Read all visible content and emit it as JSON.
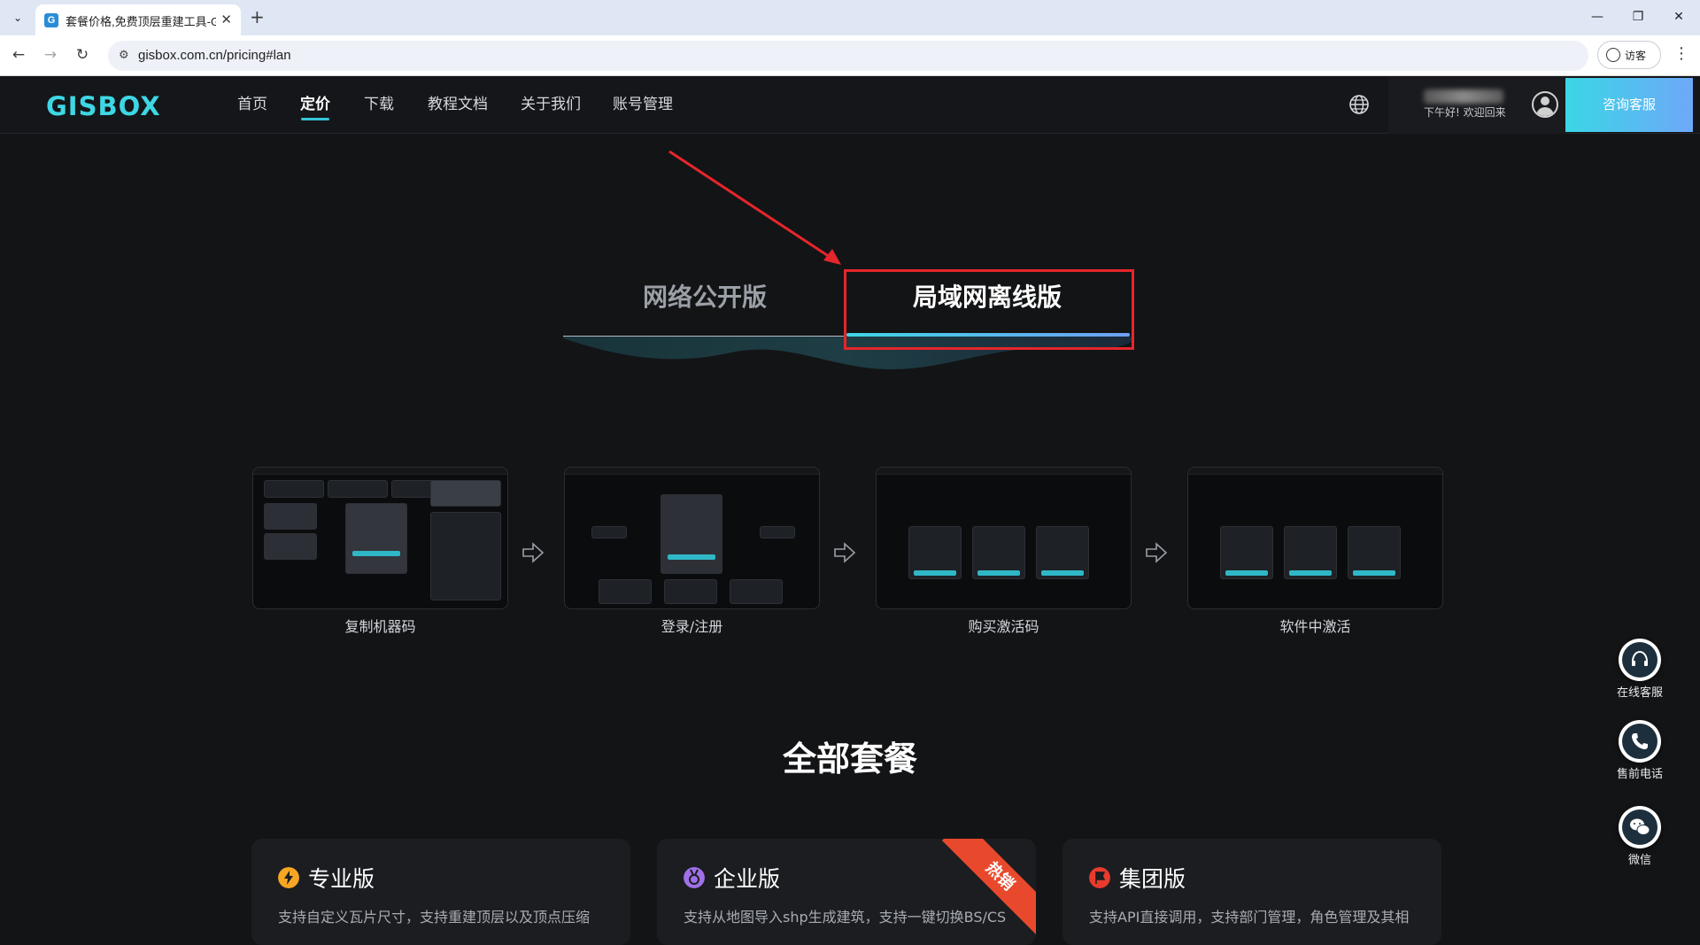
{
  "browser": {
    "tab_title": "套餐价格,免费顶层重建工具-GI",
    "tab_favicon": "G",
    "tab_close": "✕",
    "new_tab": "+",
    "url": "gisbox.com.cn/pricing#lan",
    "guest_label": "访客",
    "window_controls": {
      "minimize": "—",
      "restore": "❐",
      "close": "✕"
    }
  },
  "site": {
    "logo": "GISBOX",
    "nav": [
      "首页",
      "定价",
      "下载",
      "教程文档",
      "关于我们",
      "账号管理"
    ],
    "active_nav": "定价",
    "greeting": "下午好! 欢迎回来",
    "consult_button": "咨询客服"
  },
  "switcher": {
    "tabs": [
      "网络公开版",
      "局域网离线版"
    ],
    "active": "局域网离线版"
  },
  "steps": [
    "复制机器码",
    "登录/注册",
    "购买激活码",
    "软件中激活"
  ],
  "plans": {
    "title": "全部套餐",
    "items": [
      {
        "name": "专业版",
        "icon": "lightning-icon",
        "icon_color": "#f5a623",
        "desc": "支持自定义瓦片尺寸，支持重建顶层以及顶点压缩"
      },
      {
        "name": "企业版",
        "icon": "medal-icon",
        "icon_color": "#a070e8",
        "desc": "支持从地图导入shp生成建筑，支持一键切换BS/CS",
        "badge": "热销"
      },
      {
        "name": "集团版",
        "icon": "flag-icon",
        "icon_color": "#e83a2d",
        "desc": "支持API直接调用，支持部门管理，角色管理及其相"
      }
    ]
  },
  "floating": [
    "在线客服",
    "售前电话",
    "微信"
  ],
  "colors": {
    "accent": "#3ed6e4",
    "highlight": "#e5262b",
    "hot": "#e8492d"
  }
}
